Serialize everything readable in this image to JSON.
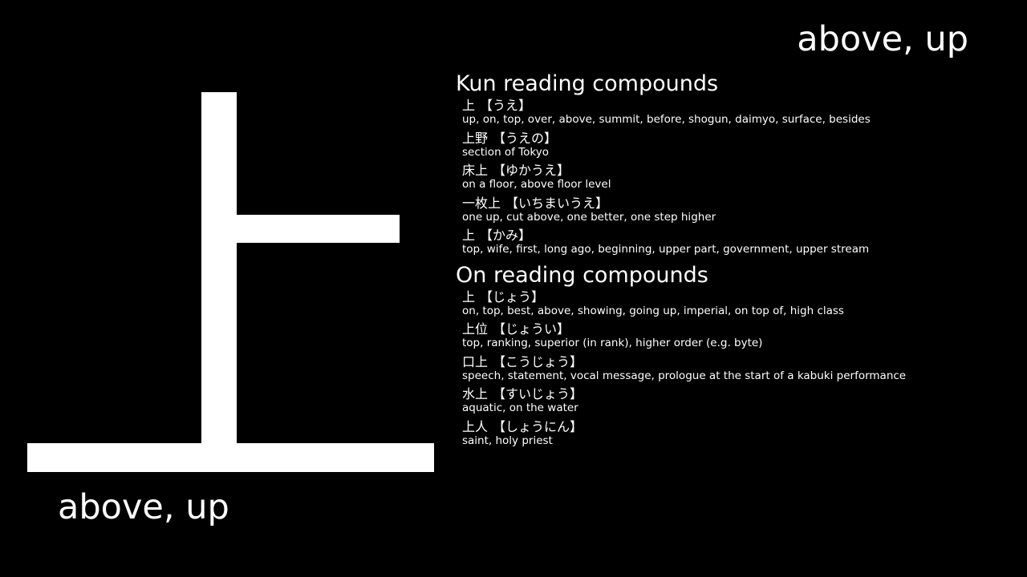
{
  "kanji": "上",
  "meaning": "above, up",
  "kun_section": {
    "heading": "Kun reading compounds",
    "entries": [
      {
        "word": "上",
        "reading": "【うえ】",
        "gloss": "up, on, top, over, above, summit, before, shogun, daimyo, surface, besides"
      },
      {
        "word": "上野",
        "reading": "【うえの】",
        "gloss": "section of Tokyo"
      },
      {
        "word": "床上",
        "reading": "【ゆかうえ】",
        "gloss": "on a floor, above floor level"
      },
      {
        "word": "一枚上",
        "reading": "【いちまいうえ】",
        "gloss": "one up, cut above, one better, one step higher"
      },
      {
        "word": "上",
        "reading": "【かみ】",
        "gloss": "top, wife, first, long ago, beginning, upper part, government, upper stream"
      }
    ]
  },
  "on_section": {
    "heading": "On reading compounds",
    "entries": [
      {
        "word": "上",
        "reading": "【じょう】",
        "gloss": "on, top, best, above, showing, going up, imperial, on top of, high class"
      },
      {
        "word": "上位",
        "reading": "【じょうい】",
        "gloss": "top, ranking, superior (in rank), higher order (e.g. byte)"
      },
      {
        "word": "口上",
        "reading": "【こうじょう】",
        "gloss": "speech, statement, vocal message, prologue at the start of a kabuki performance"
      },
      {
        "word": "水上",
        "reading": "【すいじょう】",
        "gloss": "aquatic, on the water"
      },
      {
        "word": "上人",
        "reading": "【しょうにん】",
        "gloss": "saint, holy priest"
      }
    ]
  }
}
